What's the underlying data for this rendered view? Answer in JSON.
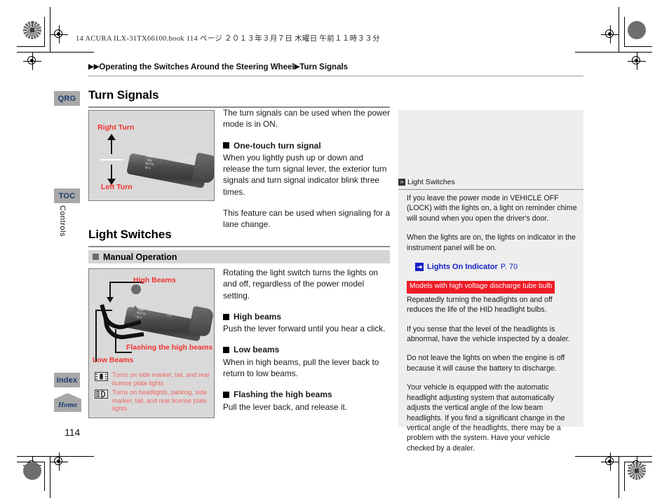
{
  "print_header": {
    "job_line": "14 ACURA ILX-31TX66100.book   114 ページ   ２０１３年３月７日   木曜日   午前１１時３３分"
  },
  "breadcrumb": {
    "arrow1": "▶",
    "arrow2": "▶",
    "part1": "Operating the Switches Around the Steering Wheel",
    "arrow3": "▶",
    "part2": "Turn Signals"
  },
  "sidebar": {
    "tabs": [
      {
        "label": "QRG"
      },
      {
        "label": "TOC"
      },
      {
        "label": "Index"
      }
    ],
    "section_label": "Controls",
    "home_label": "Home"
  },
  "page_number": "114",
  "sections": {
    "turn_signals": {
      "title": "Turn Signals",
      "illustration": {
        "label_top": "Right Turn",
        "label_bottom": "Left Turn"
      },
      "intro": "The turn signals can be used when the power mode is in ON.",
      "subsections": [
        {
          "heading": "One-touch turn signal",
          "body": "When you lightly push up or down and release the turn signal lever, the exterior turn signals and turn signal indicator blink three times.",
          "body2": "This feature can be used when signaling for a lane change."
        }
      ]
    },
    "light_switches": {
      "title": "Light Switches",
      "banner_heading": "Manual Operation",
      "illustration": {
        "label_high": "High Beams",
        "label_flash": "Flashing the high beams",
        "label_low": "Low Beams",
        "legend": [
          {
            "icon": "side-marker-lights-icon",
            "text": "Turns on side marker, tail, and rear license plate lights"
          },
          {
            "icon": "headlights-icon",
            "text": "Turns on headlights, parking, side marker, tail, and rear license plate lights"
          }
        ]
      },
      "intro": "Rotating the light switch turns the lights on and off, regardless of the power model setting.",
      "subsections": [
        {
          "heading": "High beams",
          "body": "Push the lever forward until you hear a click."
        },
        {
          "heading": "Low beams",
          "body": "When in high beams, pull the lever back to return to low beams."
        },
        {
          "heading": "Flashing the high beams",
          "body": "Pull the lever back, and release it."
        }
      ]
    }
  },
  "note_panel": {
    "header_glyph": "»",
    "header_title": "Light Switches",
    "paragraphs": [
      "If you leave the power mode in VEHICLE OFF (LOCK) with the lights on, a light on reminder chime will sound when you open the driver's door.",
      "When the lights are on, the lights on indicator in the instrument panel will be on."
    ],
    "link": {
      "icon_glyph": "⇥",
      "label": "Lights On Indicator",
      "page": "P. 70"
    },
    "red_banner": "Models with high voltage discharge tube bulb",
    "paragraphs_after": [
      "Repeatedly turning the headlights on and off reduces the life of the HID headlight bulbs.",
      "If you sense that the level of the headlights is abnormal, have the vehicle inspected by a dealer.",
      "Do not leave the lights on when the engine is off because it will cause the battery to discharge.",
      "Your vehicle is equipped with the automatic headlight adjusting system that automatically adjusts the vertical angle of the low beam headlights. If you find a significant change in the vertical angle of the headlights, there may be a problem with the system. Have your vehicle checked by a dealer."
    ]
  },
  "colors": {
    "red_label": "#f0322e",
    "link_blue": "#1420c8",
    "tab_gray": "#a8a8a8",
    "tab_text": "#1c3b6e",
    "banner_red": "#ee1b24"
  }
}
